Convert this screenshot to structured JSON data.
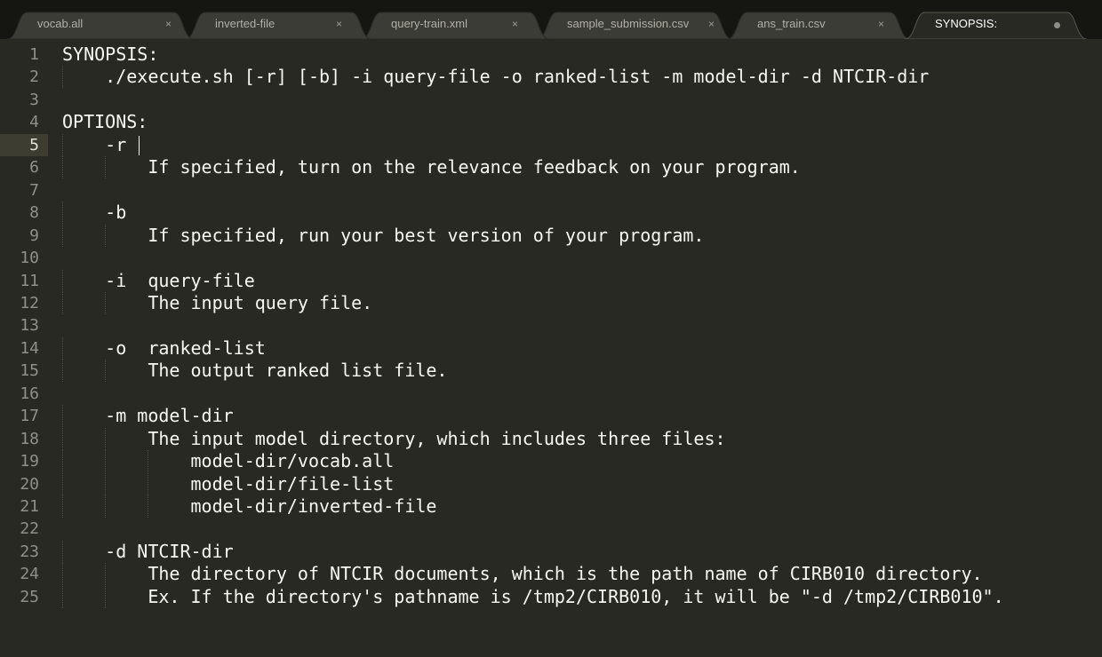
{
  "tabs": [
    {
      "label": "vocab.all",
      "close": "×",
      "active": false
    },
    {
      "label": "inverted-file",
      "close": "×",
      "active": false
    },
    {
      "label": "query-train.xml",
      "close": "×",
      "active": false
    },
    {
      "label": "sample_submission.csv",
      "close": "×",
      "active": false
    },
    {
      "label": "ans_train.csv",
      "close": "×",
      "active": false
    },
    {
      "label": "SYNOPSIS:",
      "active": true,
      "modified": true
    }
  ],
  "editor": {
    "current_line": 5,
    "lines": [
      "SYNOPSIS:",
      "    ./execute.sh [-r] [-b] -i query-file -o ranked-list -m model-dir -d NTCIR-dir",
      "",
      "OPTIONS:",
      "    -r ",
      "        If specified, turn on the relevance feedback on your program.",
      "",
      "    -b",
      "        If specified, run your best version of your program.",
      "",
      "    -i  query-file",
      "        The input query file.",
      "",
      "    -o  ranked-list",
      "        The output ranked list file.",
      "",
      "    -m model-dir",
      "        The input model directory, which includes three files:",
      "            model-dir/vocab.all",
      "            model-dir/file-list",
      "            model-dir/inverted-file",
      "",
      "    -d NTCIR-dir",
      "        The directory of NTCIR documents, which is the path name of CIRB010 directory.",
      "        Ex. If the directory's pathname is /tmp2/CIRB010, it will be \"-d /tmp2/CIRB010\"."
    ]
  }
}
